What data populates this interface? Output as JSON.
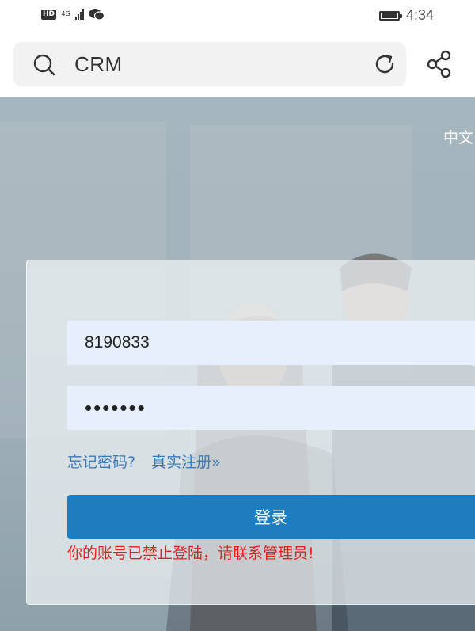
{
  "status_bar": {
    "hd_badge": "HD",
    "network_type": "4G",
    "time": "4:34"
  },
  "browser": {
    "url_text": "CRM",
    "icons": [
      "search-icon",
      "reload-icon",
      "share-icon"
    ]
  },
  "page": {
    "language_link": "中文",
    "login_form": {
      "username_value": "8190833",
      "password_mask": "•••••••",
      "forgot_password_link": "忘记密码?",
      "register_link": "真实注册»",
      "login_button_label": "登录",
      "error_message": "你的账号已禁止登陆，请联系管理员!"
    }
  },
  "colors": {
    "login_button": "#1d7dbe",
    "link": "#3a7ab8",
    "error": "#e21f1f",
    "input_bg": "#e8effc"
  }
}
